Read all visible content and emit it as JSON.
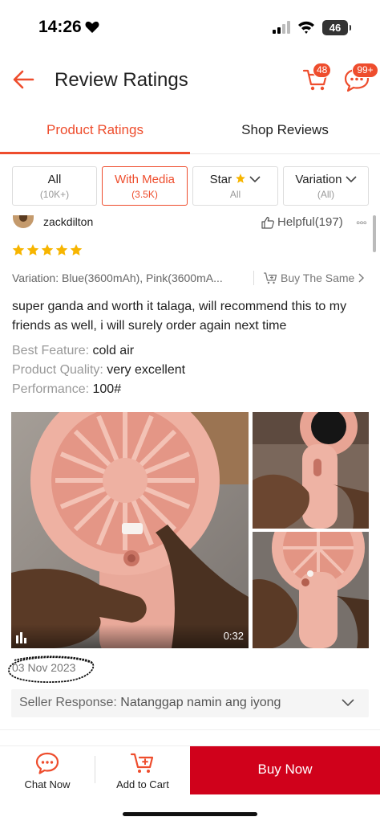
{
  "status": {
    "time": "14:26",
    "battery": "46"
  },
  "header": {
    "title": "Review Ratings",
    "cart_count": "48",
    "chat_count": "99+"
  },
  "tabs": [
    {
      "label": "Product Ratings"
    },
    {
      "label": "Shop Reviews"
    }
  ],
  "filters": [
    {
      "label": "All",
      "count": "(10K+)"
    },
    {
      "label": "With Media",
      "count": "(3.5K)"
    },
    {
      "label": "Star",
      "count": "All"
    },
    {
      "label": "Variation",
      "count": "(All)"
    }
  ],
  "review": {
    "username": "zackdilton",
    "helpful": "Helpful(197)",
    "rating": 5,
    "variation": "Variation: Blue(3600mAh), Pink(3600mA...",
    "buy_same": "Buy The Same",
    "comment": "super ganda and worth it talaga, will recommend this to my friends as well, i will surely order again next time",
    "attributes": [
      {
        "key": "Best Feature:",
        "value": "cold air"
      },
      {
        "key": "Product Quality:",
        "value": "very excellent"
      },
      {
        "key": "Performance:",
        "value": "100#"
      }
    ],
    "video_duration": "0:32",
    "date": "03 Nov 2023",
    "seller_response_label": "Seller Response:",
    "seller_response_text": "Natanggap namin ang iyong"
  },
  "bottom": {
    "chat": "Chat Now",
    "add_to_cart": "Add to Cart",
    "buy_now": "Buy Now"
  },
  "colors": {
    "accent": "#ee4d2d",
    "buy_now": "#d0011b",
    "star": "#f7b500"
  }
}
